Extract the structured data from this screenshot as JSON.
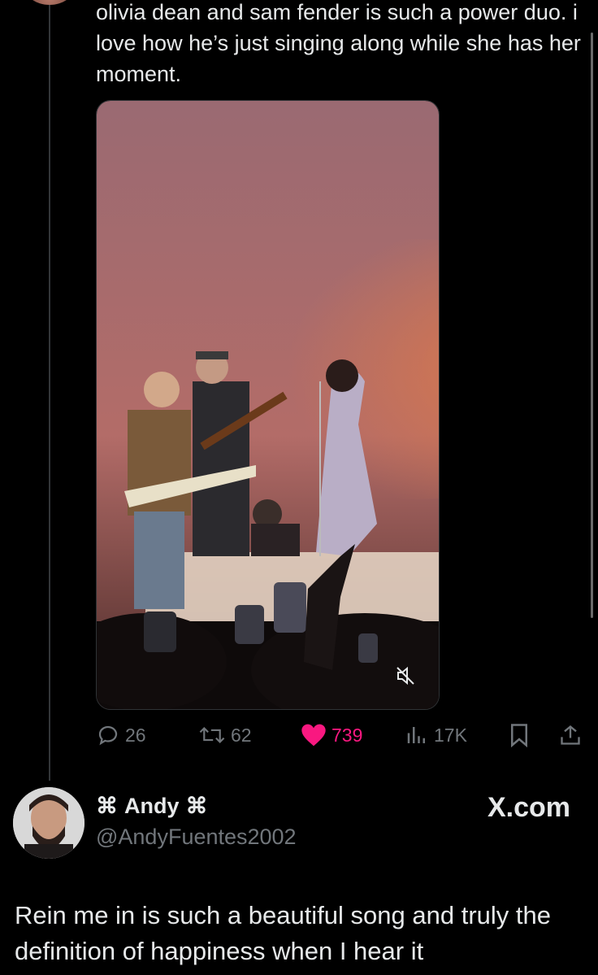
{
  "tweet": {
    "text": "olivia dean and sam fender is such a power duo. i love how he’s just singing along while she has her moment.",
    "media_alt": "concert video",
    "replies": "26",
    "reposts": "62",
    "likes": "739",
    "views": "17K",
    "colors": {
      "like": "#f91880",
      "muted": "#71767b",
      "background": "#000000"
    }
  },
  "author": {
    "name": "Andy",
    "name_symbol": "⌘",
    "handle": "@AndyFuentes2002"
  },
  "brand": {
    "label": "X.com"
  },
  "caption": {
    "text": "Rein me in is such a beautiful song and truly the definition of happiness when I hear it"
  }
}
